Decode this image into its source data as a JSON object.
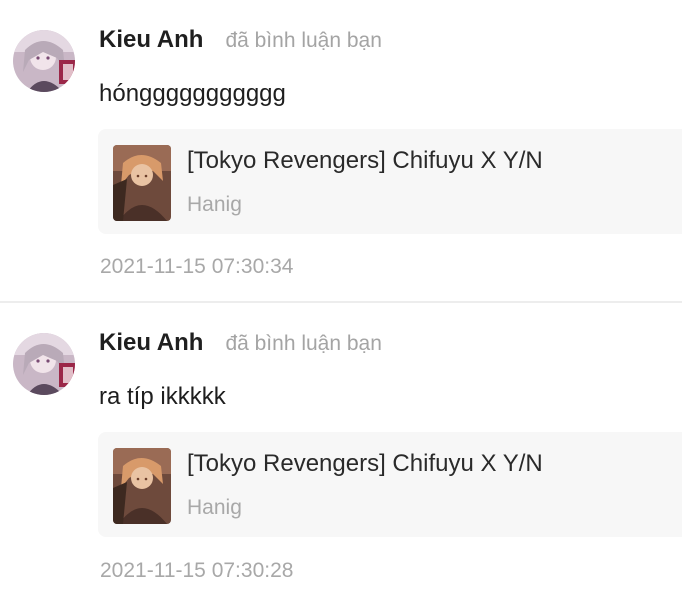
{
  "notifications": [
    {
      "user": {
        "name": "Kieu Anh",
        "avatar_icon": "user-avatar"
      },
      "action": "đã bình luận bạn",
      "comment": "hónggggggggggg",
      "story": {
        "title": "[Tokyo Revengers] Chifuyu X Y/N",
        "author": "Hanig",
        "cover_icon": "story-cover"
      },
      "timestamp": "2021-11-15 07:30:34"
    },
    {
      "user": {
        "name": "Kieu Anh",
        "avatar_icon": "user-avatar"
      },
      "action": "đã bình luận bạn",
      "comment": "ra típ ikkkkk",
      "story": {
        "title": "[Tokyo Revengers] Chifuyu X Y/N",
        "author": "Hanig",
        "cover_icon": "story-cover"
      },
      "timestamp": "2021-11-15 07:30:28"
    }
  ],
  "colors": {
    "username": "#1f1f1f",
    "muted_text": "#a4a4a4",
    "card_background": "#f7f7f7",
    "divider": "#ededed"
  }
}
